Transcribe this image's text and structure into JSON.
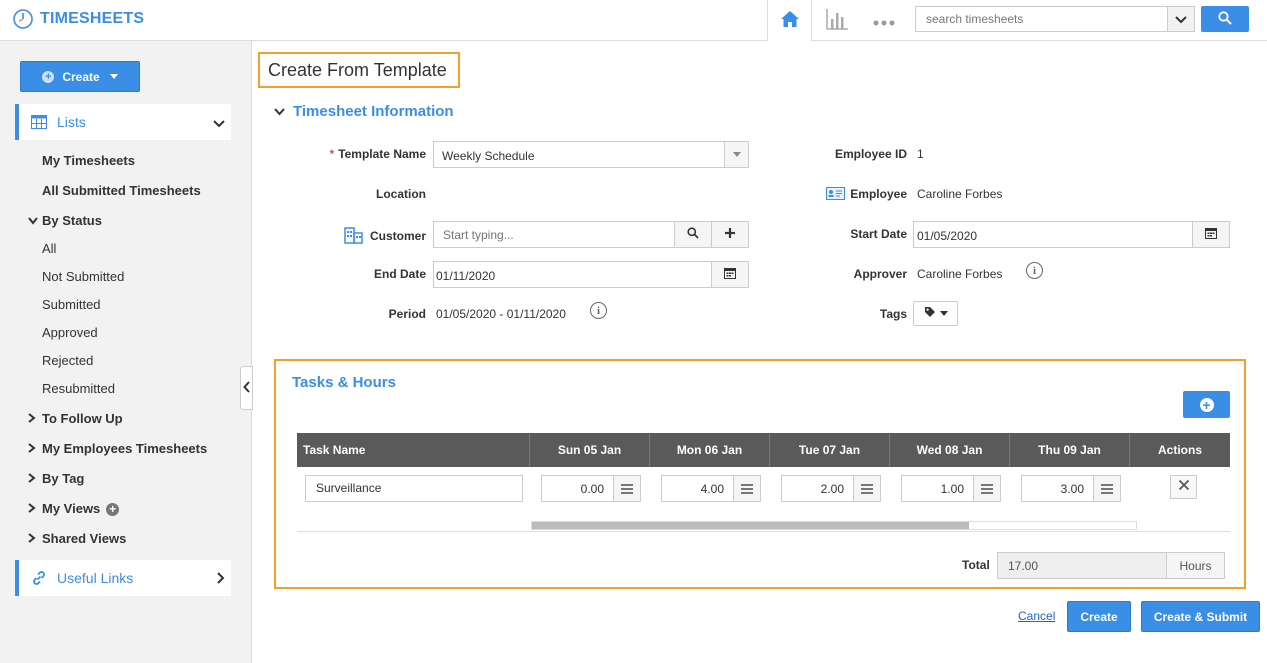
{
  "app": {
    "title": "TIMESHEETS"
  },
  "search": {
    "placeholder": "search timesheets"
  },
  "sidebar": {
    "create_label": "Create",
    "lists_label": "Lists",
    "items": {
      "my_timesheets": "My Timesheets",
      "all_submitted": "All Submitted Timesheets",
      "by_status": "By Status",
      "all": "All",
      "not_submitted": "Not Submitted",
      "submitted": "Submitted",
      "approved": "Approved",
      "rejected": "Rejected",
      "resubmitted": "Resubmitted",
      "to_follow_up": "To Follow Up",
      "my_employees": "My Employees Timesheets",
      "by_tag": "By Tag",
      "my_views": "My Views",
      "shared_views": "Shared Views"
    },
    "useful_links_label": "Useful Links"
  },
  "page": {
    "title": "Create From Template"
  },
  "timesheet_info": {
    "section_title": "Timesheet Information",
    "template_name_label": "Template Name",
    "template_name_value": "Weekly Schedule",
    "location_label": "Location",
    "customer_label": "Customer",
    "customer_placeholder": "Start typing...",
    "end_date_label": "End Date",
    "end_date_value": "01/11/2020",
    "period_label": "Period",
    "period_value": "01/05/2020 - 01/11/2020",
    "employee_id_label": "Employee ID",
    "employee_id_value": "1",
    "employee_label": "Employee",
    "employee_value": "Caroline Forbes",
    "start_date_label": "Start Date",
    "start_date_value": "01/05/2020",
    "approver_label": "Approver",
    "approver_value": "Caroline Forbes",
    "tags_label": "Tags"
  },
  "tasks": {
    "section_title": "Tasks & Hours",
    "columns": [
      "Task Name",
      "Sun 05 Jan",
      "Mon 06 Jan",
      "Tue 07 Jan",
      "Wed 08 Jan",
      "Thu 09 Jan",
      "Actions"
    ],
    "rows": [
      {
        "task": "Surveillance",
        "hours": [
          "0.00",
          "4.00",
          "2.00",
          "1.00",
          "3.00"
        ]
      }
    ],
    "total_label": "Total",
    "total_value": "17.00",
    "total_unit": "Hours"
  },
  "actions": {
    "cancel_label": "Cancel",
    "create_label": "Create",
    "create_submit_label": "Create & Submit"
  },
  "colors": {
    "accent": "#3a8ee6",
    "highlight": "#f0a030",
    "table_header": "#5a5a5a"
  }
}
